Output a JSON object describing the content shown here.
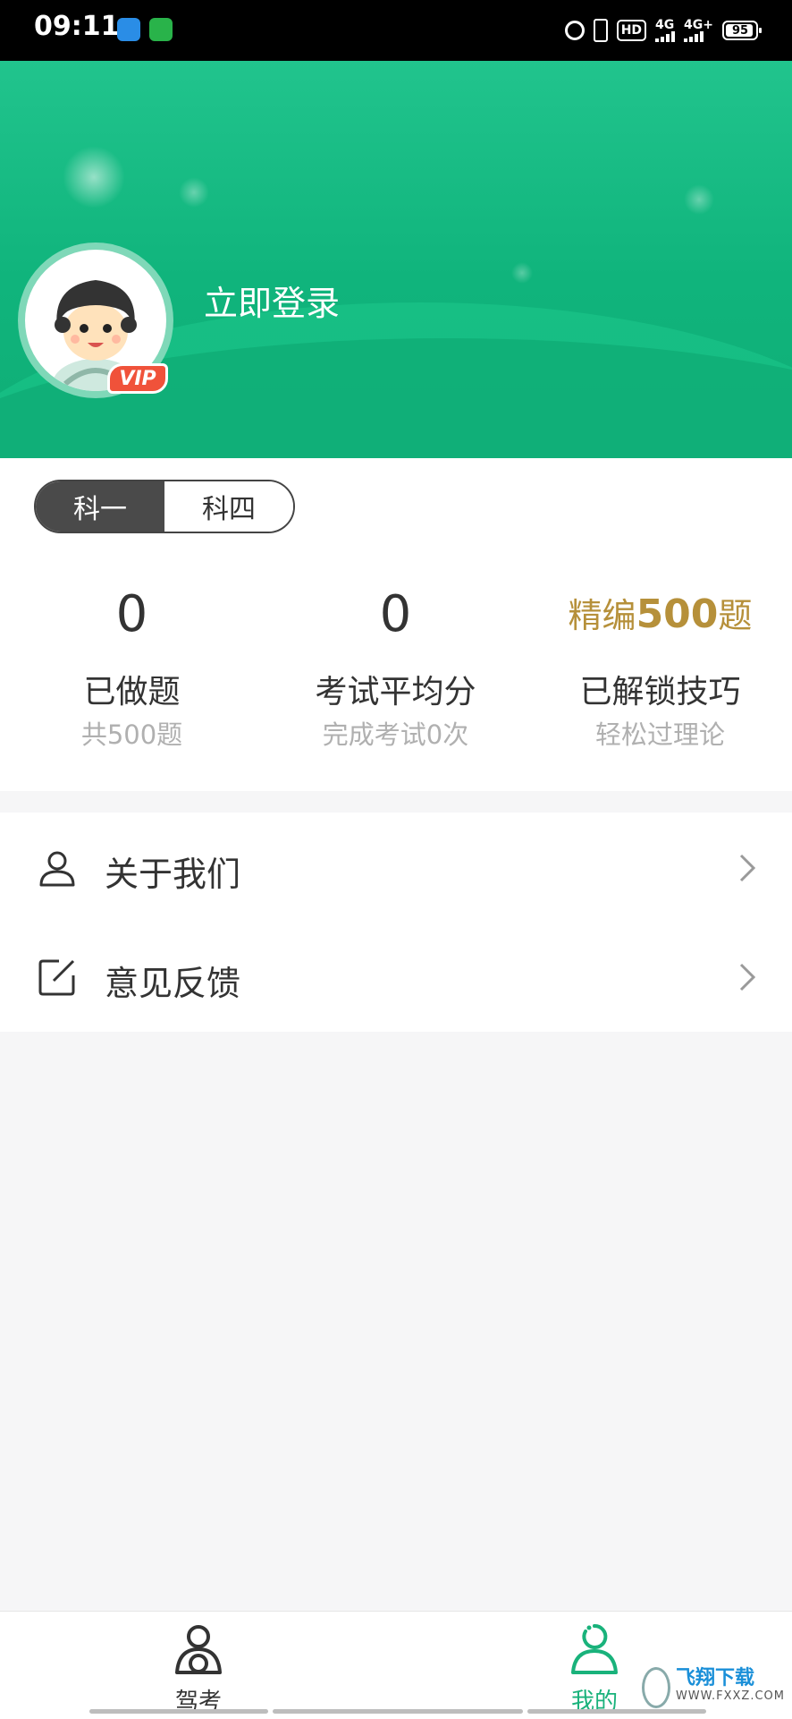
{
  "status_bar": {
    "time": "09:11",
    "hd": "HD",
    "net1": "4G",
    "net2": "4G+",
    "battery": "95",
    "battery_level": 0.95
  },
  "header": {
    "login_label": "立即登录",
    "vip_badge": "VIP"
  },
  "subject_tabs": [
    {
      "label": "科一",
      "active": true
    },
    {
      "label": "科四",
      "active": false
    }
  ],
  "stats": [
    {
      "number": "0",
      "title": "已做题",
      "subtitle": "共500题"
    },
    {
      "number": "0",
      "title": "考试平均分",
      "subtitle": "完成考试0次"
    },
    {
      "highlight_prefix": "精编",
      "highlight_number": "500",
      "highlight_suffix": "题",
      "title": "已解锁技巧",
      "subtitle": "轻松过理论"
    }
  ],
  "menu": [
    {
      "label": "关于我们",
      "icon": "person-icon"
    },
    {
      "label": "意见反馈",
      "icon": "edit-icon"
    }
  ],
  "tabbar": [
    {
      "label": "驾考",
      "icon": "driver-icon",
      "active": false
    },
    {
      "label": "我的",
      "icon": "profile-icon",
      "active": true
    }
  ],
  "watermark": {
    "name": "飞翔下载",
    "url": "WWW.FXXZ.COM"
  },
  "colors": {
    "brand_green": "#10b47c",
    "active_tab": "#19b27b",
    "gold": "#b6903a"
  }
}
